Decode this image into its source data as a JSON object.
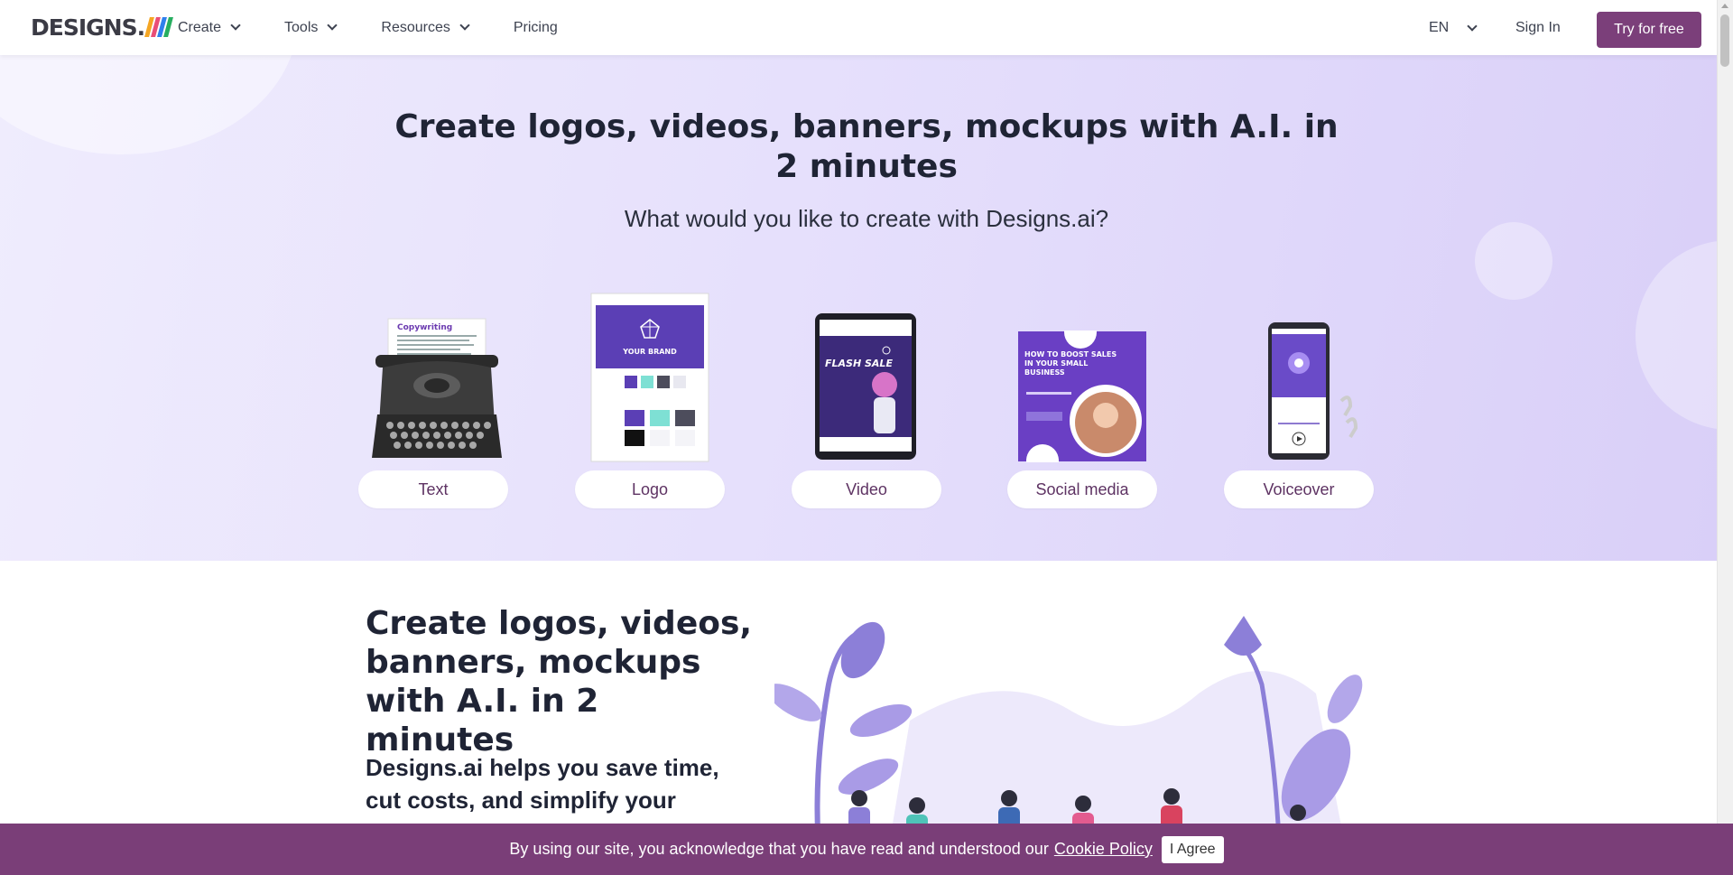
{
  "header": {
    "logo_text": "DESIGNS.",
    "logo_ai_colors": [
      "#f5a623",
      "#e94e77",
      "#2f80ed",
      "#27ae60"
    ],
    "nav": [
      {
        "label": "Create",
        "has_dropdown": true
      },
      {
        "label": "Tools",
        "has_dropdown": true
      },
      {
        "label": "Resources",
        "has_dropdown": true
      },
      {
        "label": "Pricing",
        "has_dropdown": false
      }
    ],
    "language": "EN",
    "sign_in": "Sign In",
    "cta": "Try for free"
  },
  "hero": {
    "title": "Create logos, videos, banners, mockups with A.I. in 2 minutes",
    "subtitle": "What would you like to create with Designs.ai?",
    "categories": [
      {
        "label": "Text",
        "icon": "typewriter-icon"
      },
      {
        "label": "Logo",
        "icon": "logo-sheet-icon"
      },
      {
        "label": "Video",
        "icon": "tablet-video-icon"
      },
      {
        "label": "Social media",
        "icon": "social-post-icon"
      },
      {
        "label": "Voiceover",
        "icon": "phone-audio-icon"
      }
    ],
    "illustration_text": {
      "copywriting": "Copywriting",
      "your_brand": "YOUR BRAND",
      "flash_sale": "FLASH SALE",
      "social_post": "HOW TO BOOST SALES IN YOUR SMALL BUSINESS"
    }
  },
  "section2": {
    "title": "Create logos, videos, banners, mockups with A.I. in 2 minutes",
    "text": "Designs.ai helps you save time, cut costs, and simplify your workflow"
  },
  "cookie": {
    "text": "By using our site, you acknowledge that you have read and understood our",
    "link": "Cookie Policy",
    "button": "I Agree"
  },
  "colors": {
    "brand": "#7b3f7a",
    "hero_bg": "#e6e0fc",
    "accent_purple": "#5b3fb5"
  }
}
